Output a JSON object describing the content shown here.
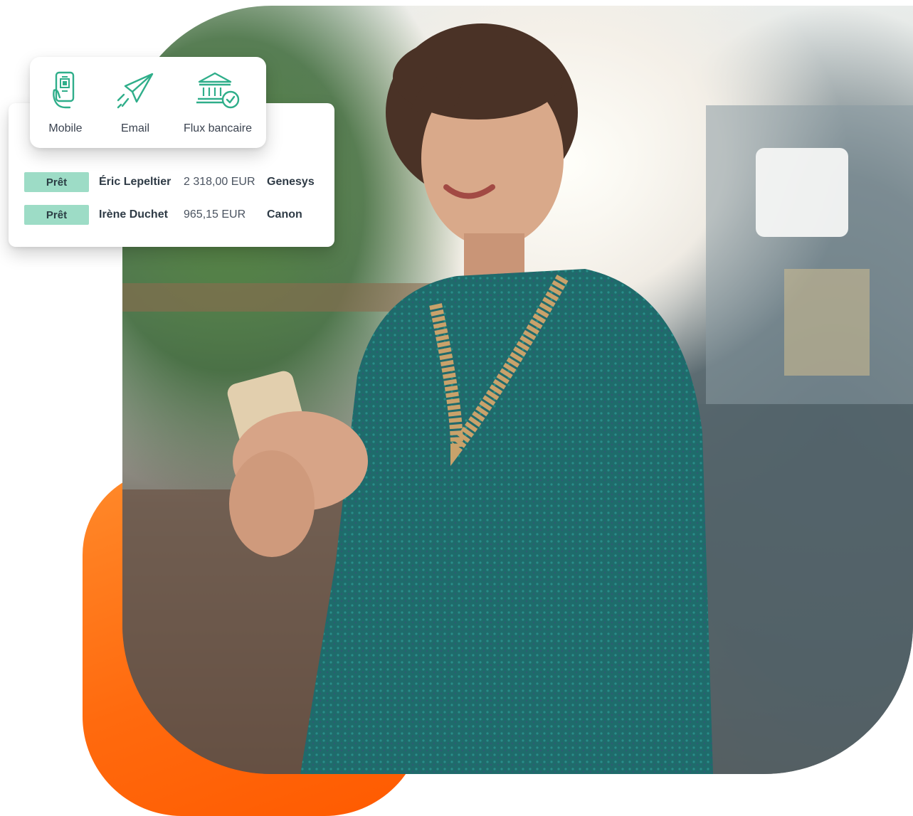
{
  "accent_color": "#2fae8a",
  "badge_color": "#9ddcc6",
  "blob_color": "#ff6a0e",
  "channels": [
    {
      "label": "Mobile",
      "icon": "mobile-scan-icon"
    },
    {
      "label": "Email",
      "icon": "paper-plane-icon"
    },
    {
      "label": "Flux bancaire",
      "icon": "bank-check-icon"
    }
  ],
  "transactions": [
    {
      "status": "Prêt",
      "name": "Éric Lepeltier",
      "amount": "2 318,00 EUR",
      "company": "Genesys"
    },
    {
      "status": "Prêt",
      "name": "Irène Duchet",
      "amount": "965,15 EUR",
      "company": "Canon"
    }
  ],
  "photo": {
    "subject": "woman-holding-phone-photo"
  }
}
